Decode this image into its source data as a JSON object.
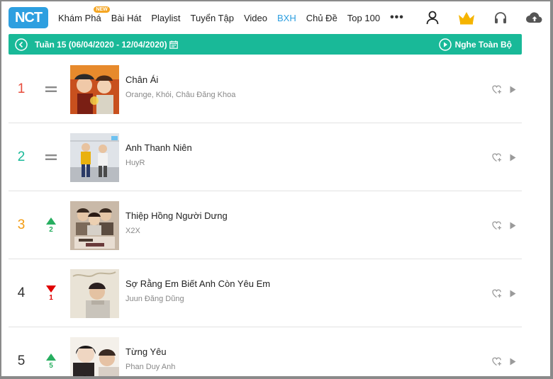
{
  "header": {
    "logo_text": "NCT",
    "nav": [
      {
        "label": "Khám Phá",
        "badge": "NEW"
      },
      {
        "label": "Bài Hát"
      },
      {
        "label": "Playlist"
      },
      {
        "label": "Tuyển Tập"
      },
      {
        "label": "Video"
      },
      {
        "label": "BXH",
        "active": true
      },
      {
        "label": "Chủ Đề"
      },
      {
        "label": "Top 100"
      }
    ],
    "more": "•••"
  },
  "weekbar": {
    "title": "Tuần 15 (06/04/2020 - 12/04/2020)",
    "play_all": "Nghe Toàn Bộ"
  },
  "songs": [
    {
      "rank": "1",
      "rank_color": "#e74c3c",
      "trend": "same",
      "change": "",
      "title": "Chân Ái",
      "artist": "Orange, Khói, Châu Đăng Khoa"
    },
    {
      "rank": "2",
      "rank_color": "#19b998",
      "trend": "same",
      "change": "",
      "title": "Anh Thanh Niên",
      "artist": "HuyR"
    },
    {
      "rank": "3",
      "rank_color": "#f39c12",
      "trend": "up",
      "change": "2",
      "title": "Thiệp Hồng Người Dưng",
      "artist": "X2X"
    },
    {
      "rank": "4",
      "rank_color": "#333333",
      "trend": "down",
      "change": "1",
      "title": "Sợ Rằng Em Biết Anh Còn Yêu Em",
      "artist": "Juun Đăng Dũng"
    },
    {
      "rank": "5",
      "rank_color": "#333333",
      "trend": "up",
      "change": "5",
      "title": "Từng Yêu",
      "artist": "Phan Duy Anh"
    }
  ],
  "colors": {
    "accent": "#2d9fe0",
    "weekbar": "#19b998",
    "up": "#27ae60",
    "down": "#e00000",
    "crown": "#f5b400"
  }
}
